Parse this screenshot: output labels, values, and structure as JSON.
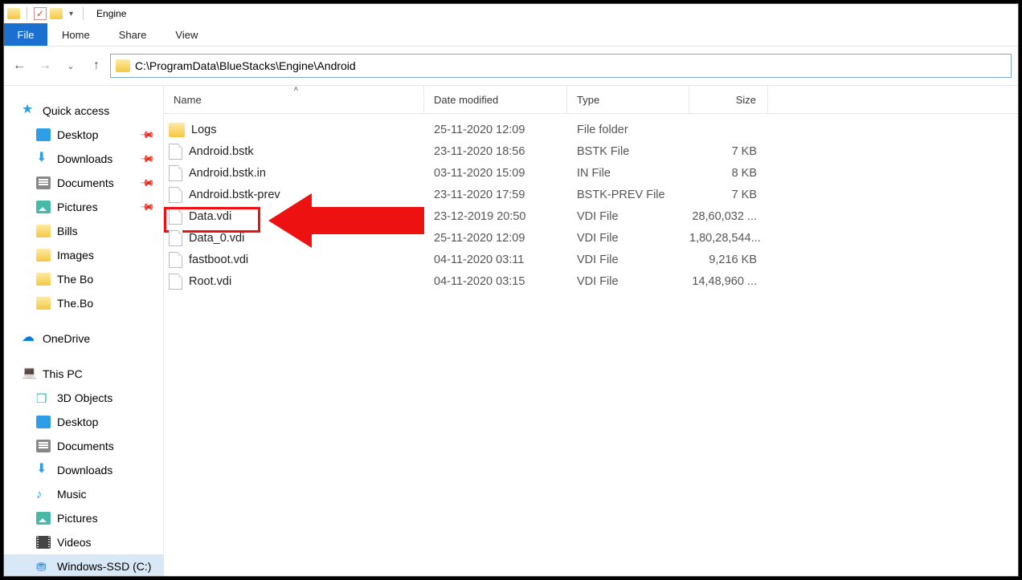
{
  "title": "Engine",
  "menu": {
    "file": "File",
    "home": "Home",
    "share": "Share",
    "view": "View"
  },
  "address_path": "C:\\ProgramData\\BlueStacks\\Engine\\Android",
  "columns": {
    "name": "Name",
    "date": "Date modified",
    "type": "Type",
    "size": "Size"
  },
  "sidebar": {
    "quick_access": "Quick access",
    "quick_items": [
      {
        "label": "Desktop",
        "icon": "desktop",
        "pinned": true
      },
      {
        "label": "Downloads",
        "icon": "dl",
        "pinned": true
      },
      {
        "label": "Documents",
        "icon": "doc",
        "pinned": true
      },
      {
        "label": "Pictures",
        "icon": "pic",
        "pinned": true
      },
      {
        "label": "Bills",
        "icon": "folder",
        "pinned": false
      },
      {
        "label": "Images",
        "icon": "folder",
        "pinned": false
      },
      {
        "label": "The Bo",
        "icon": "folder",
        "pinned": false
      },
      {
        "label": "The.Bo",
        "icon": "folder",
        "pinned": false
      }
    ],
    "onedrive": "OneDrive",
    "thispc": "This PC",
    "pc_items": [
      {
        "label": "3D Objects",
        "icon": "cube"
      },
      {
        "label": "Desktop",
        "icon": "desktop"
      },
      {
        "label": "Documents",
        "icon": "doc"
      },
      {
        "label": "Downloads",
        "icon": "dl"
      },
      {
        "label": "Music",
        "icon": "music"
      },
      {
        "label": "Pictures",
        "icon": "pic"
      },
      {
        "label": "Videos",
        "icon": "video"
      },
      {
        "label": "Windows-SSD (C:)",
        "icon": "ssd",
        "selected": true
      }
    ]
  },
  "files": [
    {
      "name": "Logs",
      "date": "25-11-2020 12:09",
      "type": "File folder",
      "size": "",
      "icon": "folder"
    },
    {
      "name": "Android.bstk",
      "date": "23-11-2020 18:56",
      "type": "BSTK File",
      "size": "7 KB",
      "icon": "file"
    },
    {
      "name": "Android.bstk.in",
      "date": "03-11-2020 15:09",
      "type": "IN File",
      "size": "8 KB",
      "icon": "file"
    },
    {
      "name": "Android.bstk-prev",
      "date": "23-11-2020 17:59",
      "type": "BSTK-PREV File",
      "size": "7 KB",
      "icon": "file"
    },
    {
      "name": "Data.vdi",
      "date": "23-12-2019 20:50",
      "type": "VDI File",
      "size": "28,60,032 ...",
      "icon": "file",
      "highlight": true
    },
    {
      "name": "Data_0.vdi",
      "date": "25-11-2020 12:09",
      "type": "VDI File",
      "size": "1,80,28,544...",
      "icon": "file"
    },
    {
      "name": "fastboot.vdi",
      "date": "04-11-2020 03:11",
      "type": "VDI File",
      "size": "9,216 KB",
      "icon": "file"
    },
    {
      "name": "Root.vdi",
      "date": "04-11-2020 03:15",
      "type": "VDI File",
      "size": "14,48,960 ...",
      "icon": "file"
    }
  ]
}
